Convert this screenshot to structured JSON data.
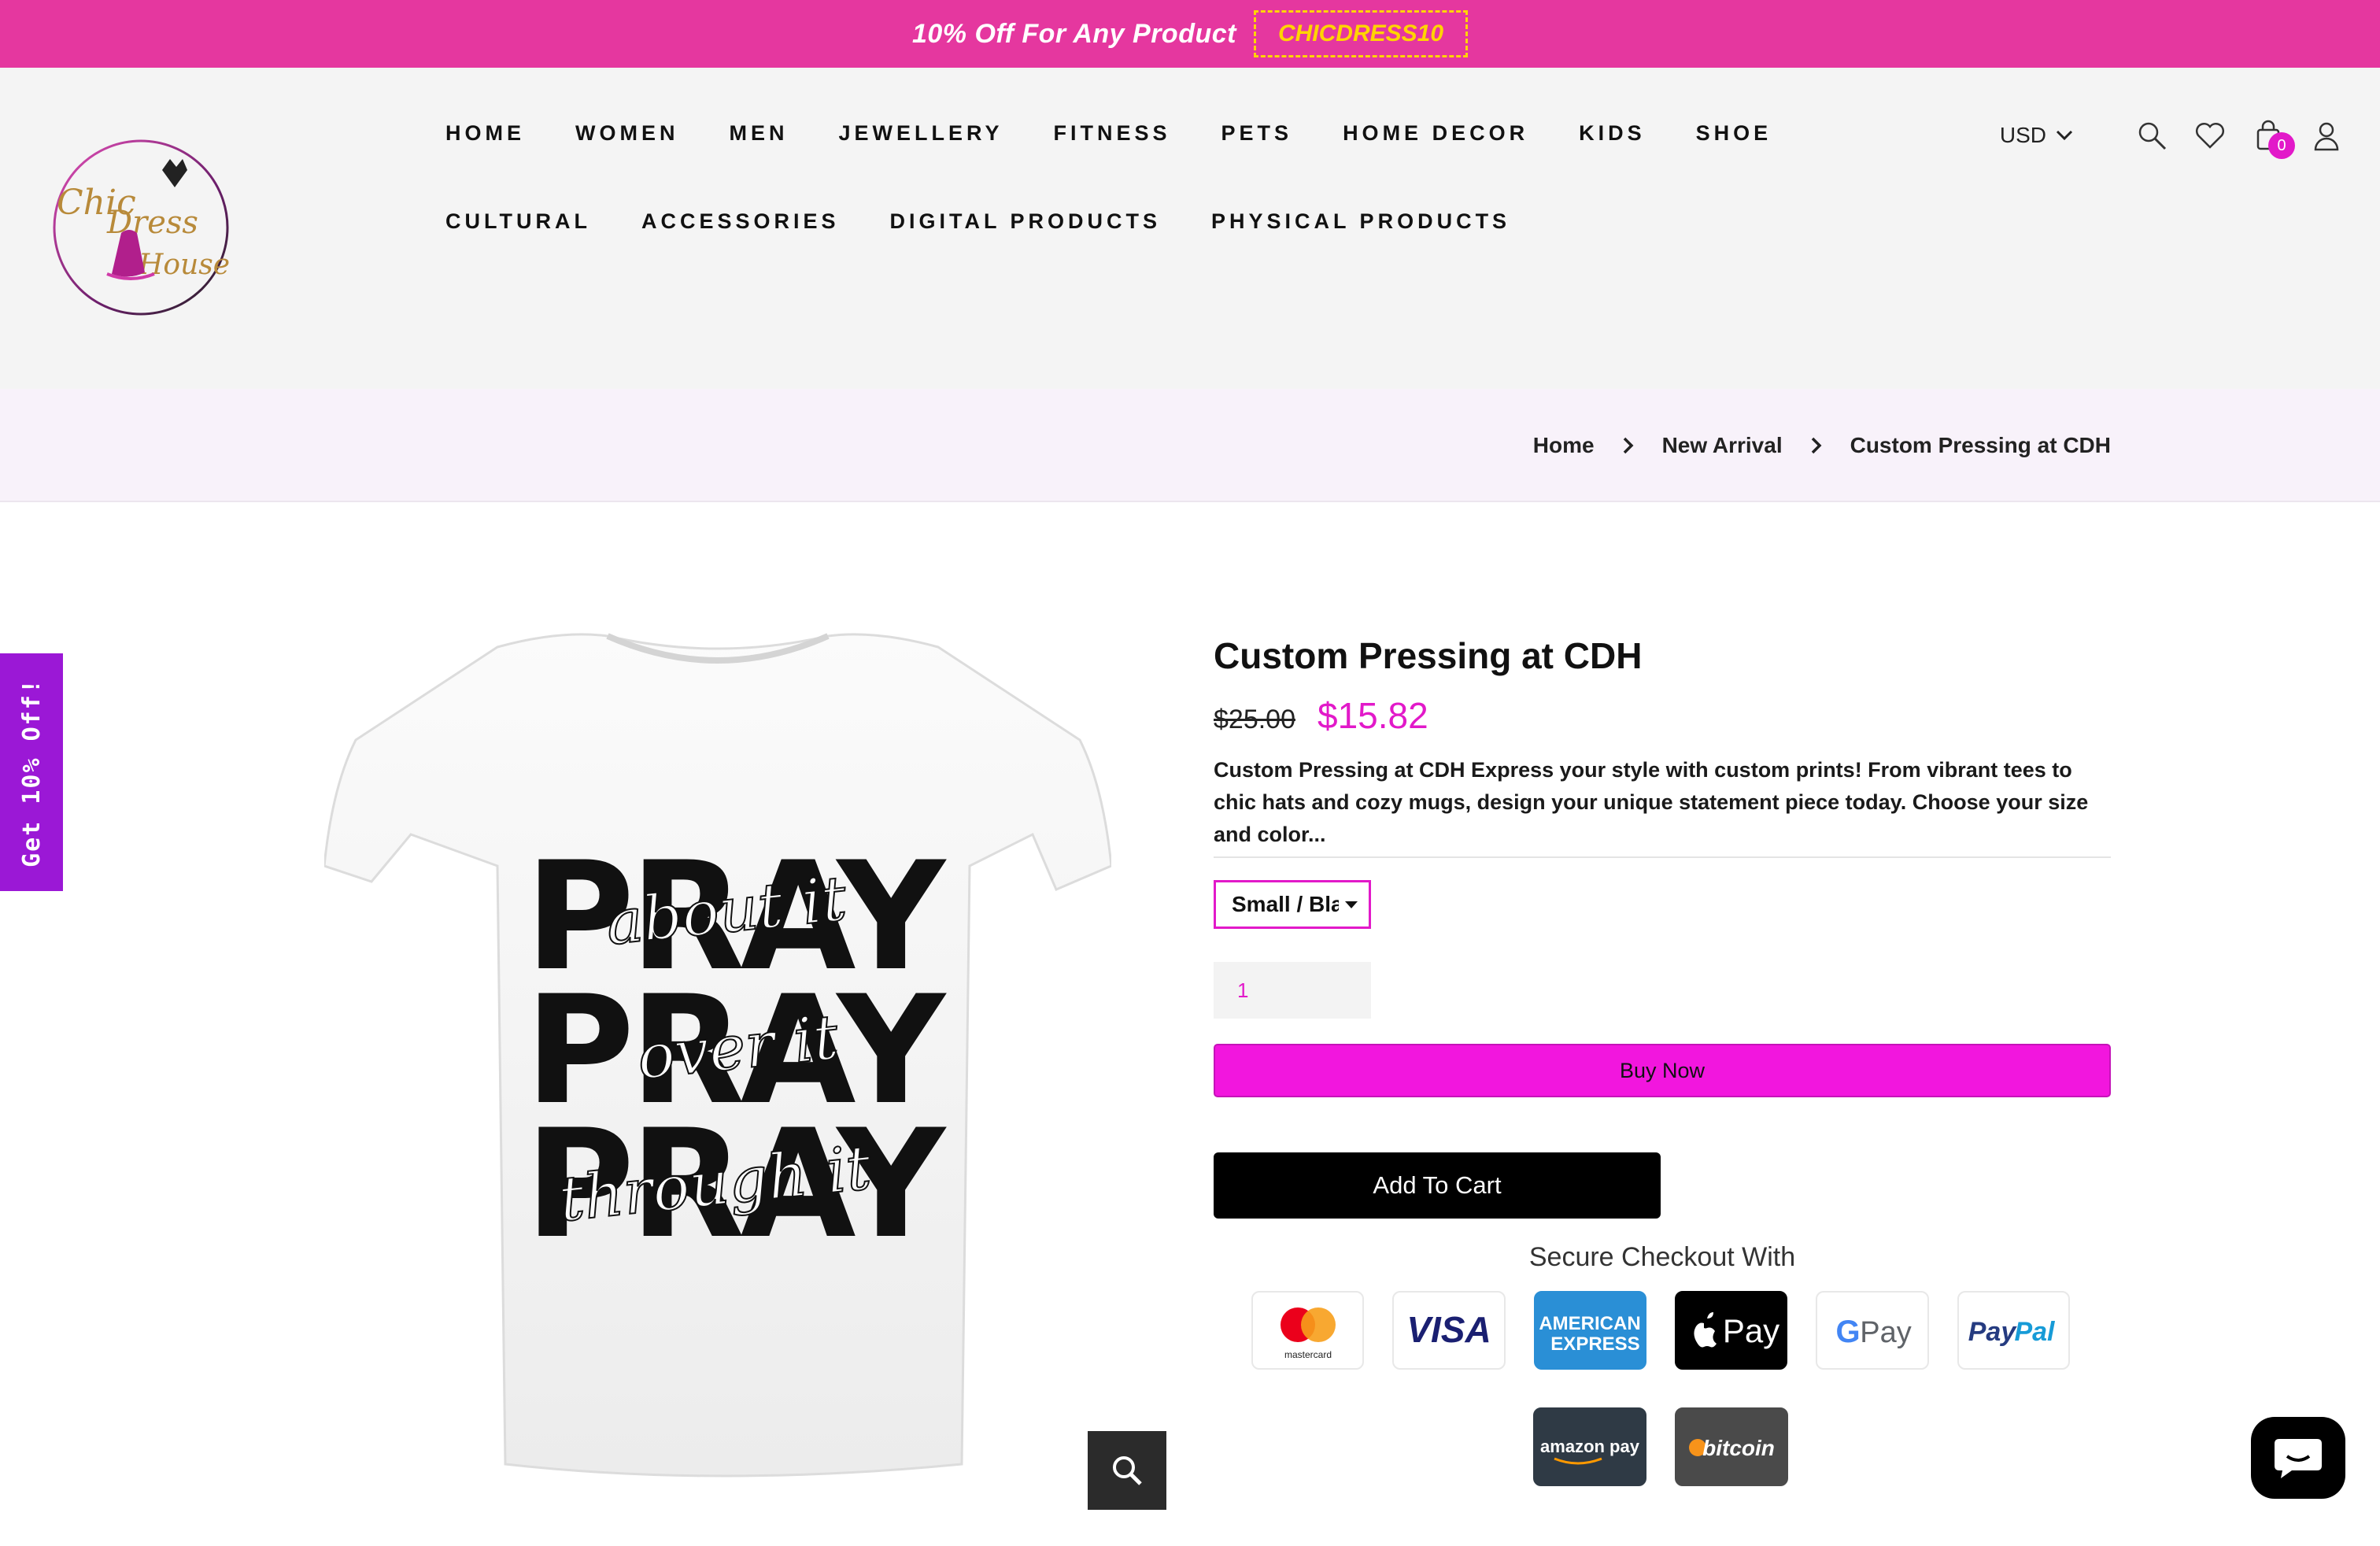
{
  "announcement": {
    "message": "10% Off For Any Product",
    "code": "CHICDRESS10"
  },
  "logo": {
    "line1": "Chic",
    "line2": "Dress",
    "line3": "House"
  },
  "nav": {
    "row1": [
      "HOME",
      "WOMEN",
      "MEN",
      "JEWELLERY",
      "FITNESS",
      "PETS",
      "HOME DECOR",
      "KIDS",
      "SHOE"
    ],
    "row2": [
      "CULTURAL",
      "ACCESSORIES",
      "DIGITAL PRODUCTS",
      "PHYSICAL PRODUCTS"
    ]
  },
  "header_tools": {
    "currency": "USD",
    "cart_count": "0"
  },
  "breadcrumb": [
    "Home",
    "New Arrival",
    "Custom Pressing at CDH"
  ],
  "side_tab": "Get 10% Off!",
  "product": {
    "title": "Custom Pressing at CDH",
    "old_price": "$25.00",
    "price": "$15.82",
    "description": "Custom Pressing at CDH Express your style with custom prints! From vibrant tees to chic hats and cozy mugs, design your unique statement piece today. Choose your size and color...",
    "variant": "Small / Black",
    "quantity": "1",
    "buy_now_label": "Buy Now",
    "add_to_cart_label": "Add To Cart",
    "shirt_print": {
      "word": "PRAY",
      "script1": "about it",
      "script2": "over it",
      "script3": "through it"
    }
  },
  "checkout": {
    "title": "Secure Checkout With",
    "methods": {
      "mastercard": "mastercard",
      "visa": "VISA",
      "amex_line1": "AMERICAN",
      "amex_line2": "EXPRESS",
      "applepay": "Pay",
      "gpay_g": "G",
      "gpay": "Pay",
      "paypal_a": "Pay",
      "paypal_b": "Pal",
      "amazon": "amazon pay",
      "bitcoin": "bitcoin"
    }
  },
  "colors": {
    "brand_pink": "#e5379f",
    "accent_magenta": "#e219c9",
    "buy_now": "#f216de",
    "side_tab": "#9b18d6"
  }
}
